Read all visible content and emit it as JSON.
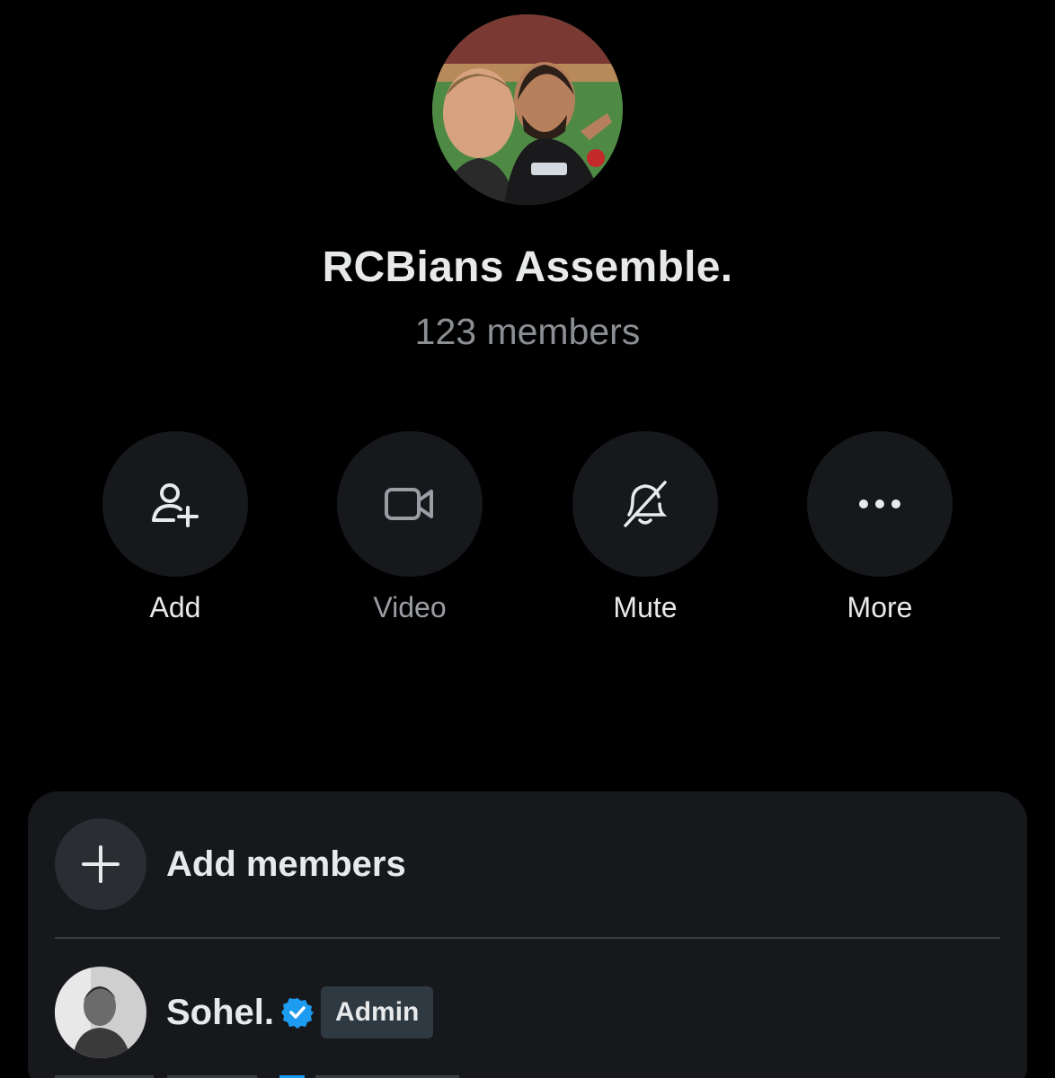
{
  "group": {
    "name": "RCBians Assemble.",
    "member_count": "123 members"
  },
  "actions": [
    {
      "label": "Add",
      "icon": "add-user-icon"
    },
    {
      "label": "Video",
      "icon": "video-camera-icon"
    },
    {
      "label": "Mute",
      "icon": "bell-off-icon"
    },
    {
      "label": "More",
      "icon": "more-dots-icon"
    }
  ],
  "members_card": {
    "add_label": "Add members",
    "members": [
      {
        "name": "Sohel.",
        "verified": true,
        "badge": "Admin"
      }
    ]
  },
  "colors": {
    "background": "#000000",
    "surface": "#16181c",
    "text": "#e7e9ea",
    "muted": "#8b8f94",
    "verified": "#1d9bf0",
    "badge": "#2f3941"
  }
}
